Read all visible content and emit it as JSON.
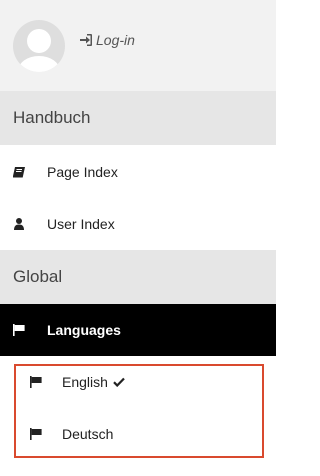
{
  "user": {
    "login_label": "Log-in"
  },
  "sections": {
    "handbuch": "Handbuch",
    "global": "Global"
  },
  "handbuch_items": {
    "page_index": "Page Index",
    "user_index": "User Index"
  },
  "global_items": {
    "languages": "Languages"
  },
  "languages": {
    "english": "English",
    "deutsch": "Deutsch"
  },
  "icons": {
    "login": "sign-in-icon",
    "page_index": "book-icon",
    "user_index": "user-icon",
    "languages": "flag-icon",
    "selected": "checkmark-icon"
  },
  "colors": {
    "highlight_border": "#d94a2e",
    "active_bg": "#000000",
    "section_bg": "#e6e6e6"
  }
}
